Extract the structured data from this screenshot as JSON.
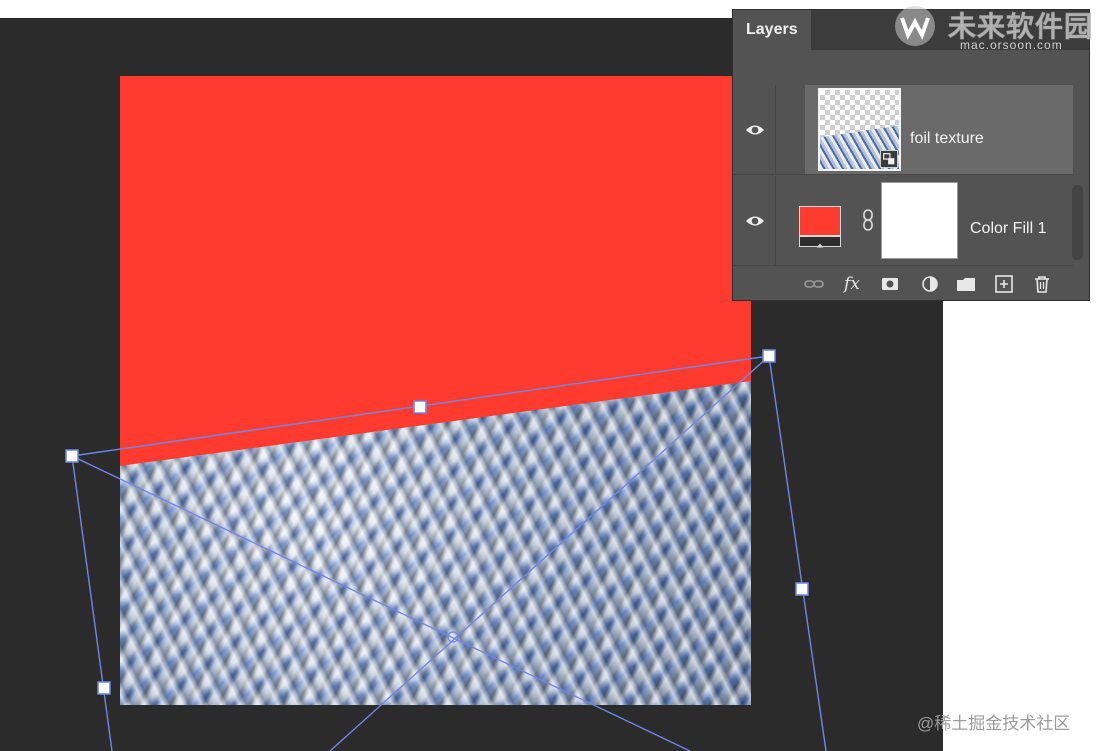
{
  "panel": {
    "tab_label": "Layers",
    "layers": [
      {
        "name": "foil texture",
        "kind": "smart-object",
        "visible": true,
        "selected": true
      },
      {
        "name": "Color Fill 1",
        "kind": "fill-layer",
        "visible": true,
        "selected": false,
        "fill_color": "#ff3b30"
      }
    ],
    "footer_icons": [
      "link-layers-icon",
      "fx-icon",
      "add-mask-icon",
      "adjustment-layer-icon",
      "new-group-icon",
      "new-layer-icon",
      "trash-icon"
    ],
    "fx_text": "fx"
  },
  "canvas": {
    "fill_color": "#ff3b30",
    "texture": "crumpled foil"
  },
  "overlay": {
    "transform_color": "#6f86e8"
  },
  "watermarks": {
    "site_name": "未来软件园",
    "site_url": "mac.orsoon.com",
    "credit": "@稀土掘金技术社区"
  },
  "colors": {
    "workspace": "#2b2b2b",
    "panel": "#535353",
    "selected_row": "#6a6a6a"
  }
}
